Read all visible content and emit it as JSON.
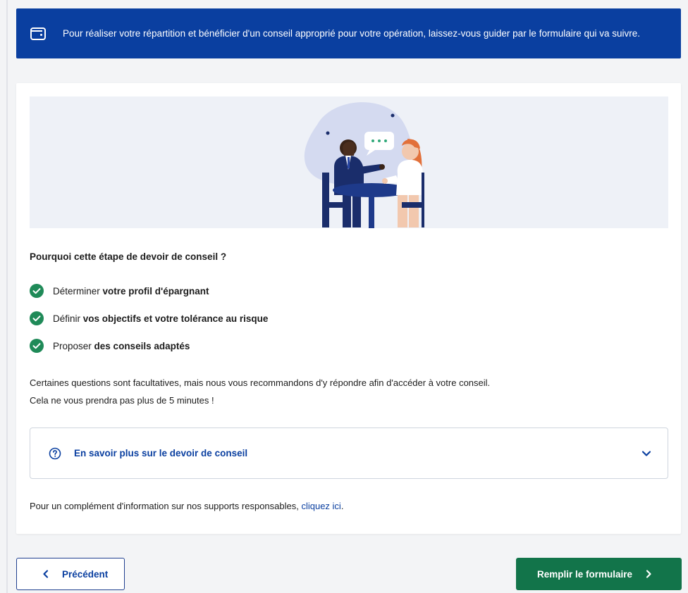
{
  "banner": {
    "icon": "wallet-icon",
    "text": "Pour réaliser votre répartition et bénéficier d'un conseil approprié pour votre opération, laissez-vous guider par le formulaire qui va suivre."
  },
  "section": {
    "title": "Pourquoi cette étape de devoir de conseil ?",
    "items": [
      {
        "prefix": "Déterminer ",
        "bold": "votre profil d'épargnant"
      },
      {
        "prefix": "Définir ",
        "bold": "vos objectifs et votre tolérance au risque"
      },
      {
        "prefix": "Proposer ",
        "bold": "des conseils adaptés"
      }
    ]
  },
  "info": {
    "line1": "Certaines questions sont facultatives, mais nous vous recommandons d'y répondre afin d'accéder à votre conseil.",
    "line2": "Cela ne vous prendra pas plus de 5 minutes !"
  },
  "accordion": {
    "label": "En savoir plus sur le devoir de conseil",
    "icon": "question-circle-icon"
  },
  "footnote": {
    "text": "Pour un complément d'information sur nos supports responsables, ",
    "link": "cliquez ici",
    "after": "."
  },
  "buttons": {
    "previous": "Précédent",
    "next": "Remplir le formulaire"
  },
  "colors": {
    "primary": "#0a3fa0",
    "success": "#12744a",
    "check": "#1f8a58"
  }
}
